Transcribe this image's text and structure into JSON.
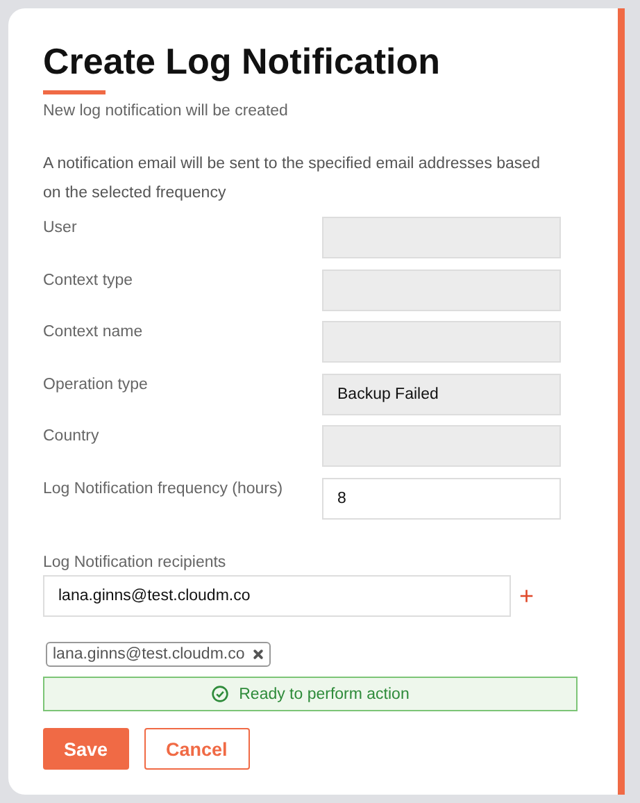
{
  "title": "Create Log Notification",
  "subtitle": "New log notification will be created",
  "description": "A notification email will be sent to the specified email addresses based on the selected frequency",
  "fields": [
    {
      "label": "User",
      "disabled": true
    },
    {
      "label": "Context type",
      "disabled": true
    },
    {
      "label": "Context name",
      "disabled": true
    },
    {
      "label": "Operation type",
      "value": "Backup Failed",
      "disabled": true
    },
    {
      "label": "Country",
      "disabled": true
    },
    {
      "label": "Log Notification frequency (hours)",
      "value": "8",
      "disabled": false
    }
  ],
  "recipients": {
    "label": "Log Notification recipients",
    "value": "lana.ginns@test.cloudm.co",
    "add_icon": "+",
    "chips": [
      {
        "text": "lana.ginns@test.cloudm.co"
      }
    ]
  },
  "status": {
    "kind": "success",
    "text": "Ready to perform action"
  },
  "buttons": [
    {
      "label": "Save",
      "kind": "primary"
    },
    {
      "label": "Cancel",
      "kind": "secondary"
    }
  ]
}
